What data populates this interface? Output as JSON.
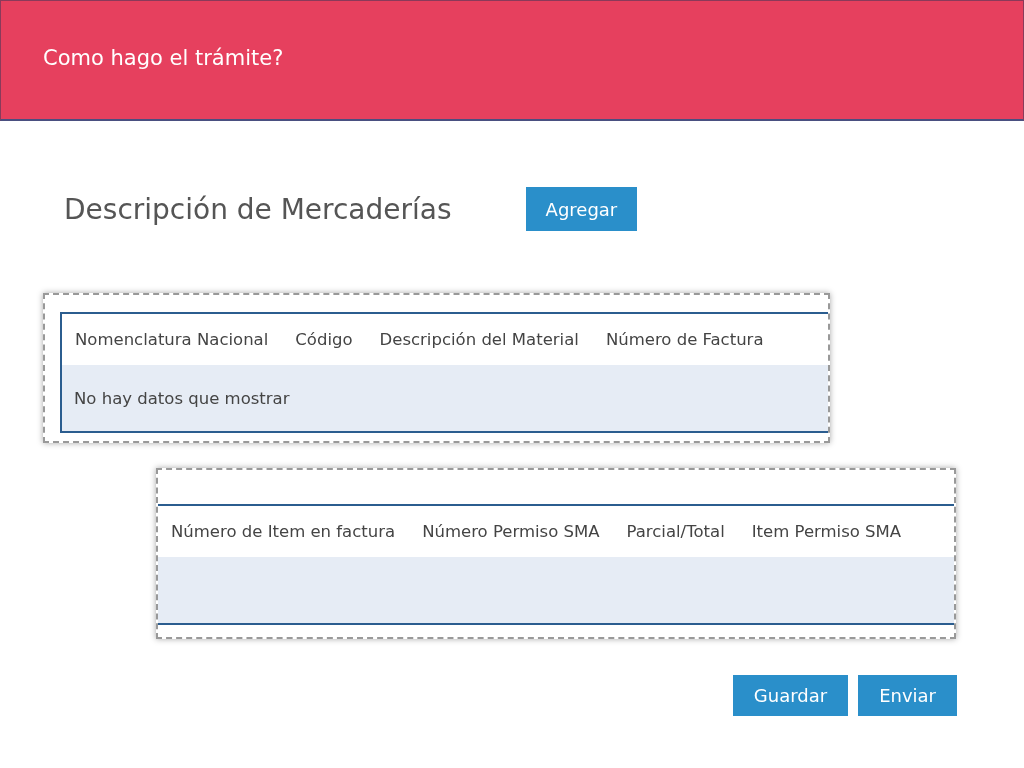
{
  "header": {
    "title": "Como hago el trámite?"
  },
  "section": {
    "title": "Descripción de Mercaderías",
    "add_button": "Agregar"
  },
  "table_1": {
    "columns": [
      "Nomenclatura Nacional",
      "Código",
      "Descripción del Material",
      "Número de Factura"
    ],
    "empty_message": "No hay datos que mostrar"
  },
  "table_2": {
    "columns": [
      "Número de Item en factura",
      "Número Permiso SMA",
      "Parcial/Total",
      "Item Permiso SMA"
    ]
  },
  "buttons": [
    "Guardar",
    "Enviar"
  ]
}
